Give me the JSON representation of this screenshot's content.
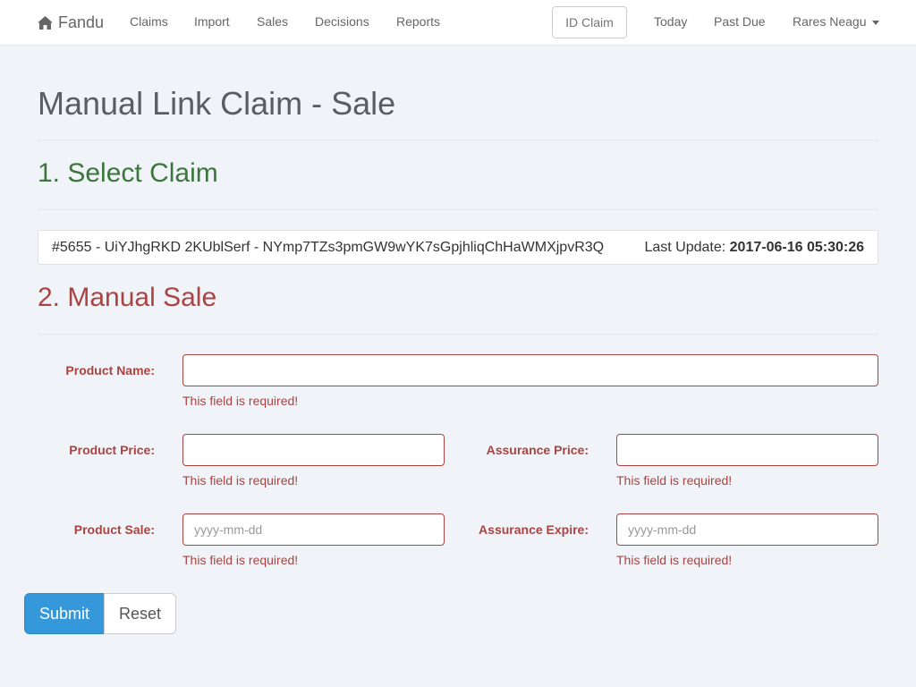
{
  "nav": {
    "brand": "Fandu",
    "links": [
      "Claims",
      "Import",
      "Sales",
      "Decisions",
      "Reports"
    ],
    "id_claim_placeholder": "ID Claim",
    "right_links": [
      "Today",
      "Past Due"
    ],
    "user": "Rares Neagu"
  },
  "page": {
    "title": "Manual Link Claim - Sale"
  },
  "select_claim": {
    "heading": "1. Select Claim",
    "claim_text": "#5655 - UiYJhgRKD 2KUblSerf - NYmp7TZs3pmGW9wYK7sGpjhliqChHaWMXjpvR3Q",
    "last_update_label": "Last Update:",
    "last_update_value": "2017-06-16 05:30:26"
  },
  "manual_sale": {
    "heading": "2. Manual Sale",
    "product_name": {
      "label": "Product Name:",
      "value": "",
      "error": "This field is required!"
    },
    "product_price": {
      "label": "Product Price:",
      "value": "",
      "error": "This field is required!"
    },
    "assurance_price": {
      "label": "Assurance Price:",
      "value": "",
      "error": "This field is required!"
    },
    "product_sale": {
      "label": "Product Sale:",
      "value": "",
      "placeholder": "yyyy-mm-dd",
      "error": "This field is required!"
    },
    "assurance_expire": {
      "label": "Assurance Expire:",
      "value": "",
      "placeholder": "yyyy-mm-dd",
      "error": "This field is required!"
    }
  },
  "buttons": {
    "submit": "Submit",
    "reset": "Reset"
  },
  "colors": {
    "accent": "#3498db",
    "success": "#3c763d",
    "danger": "#a94442",
    "background": "#f0f3f7"
  }
}
